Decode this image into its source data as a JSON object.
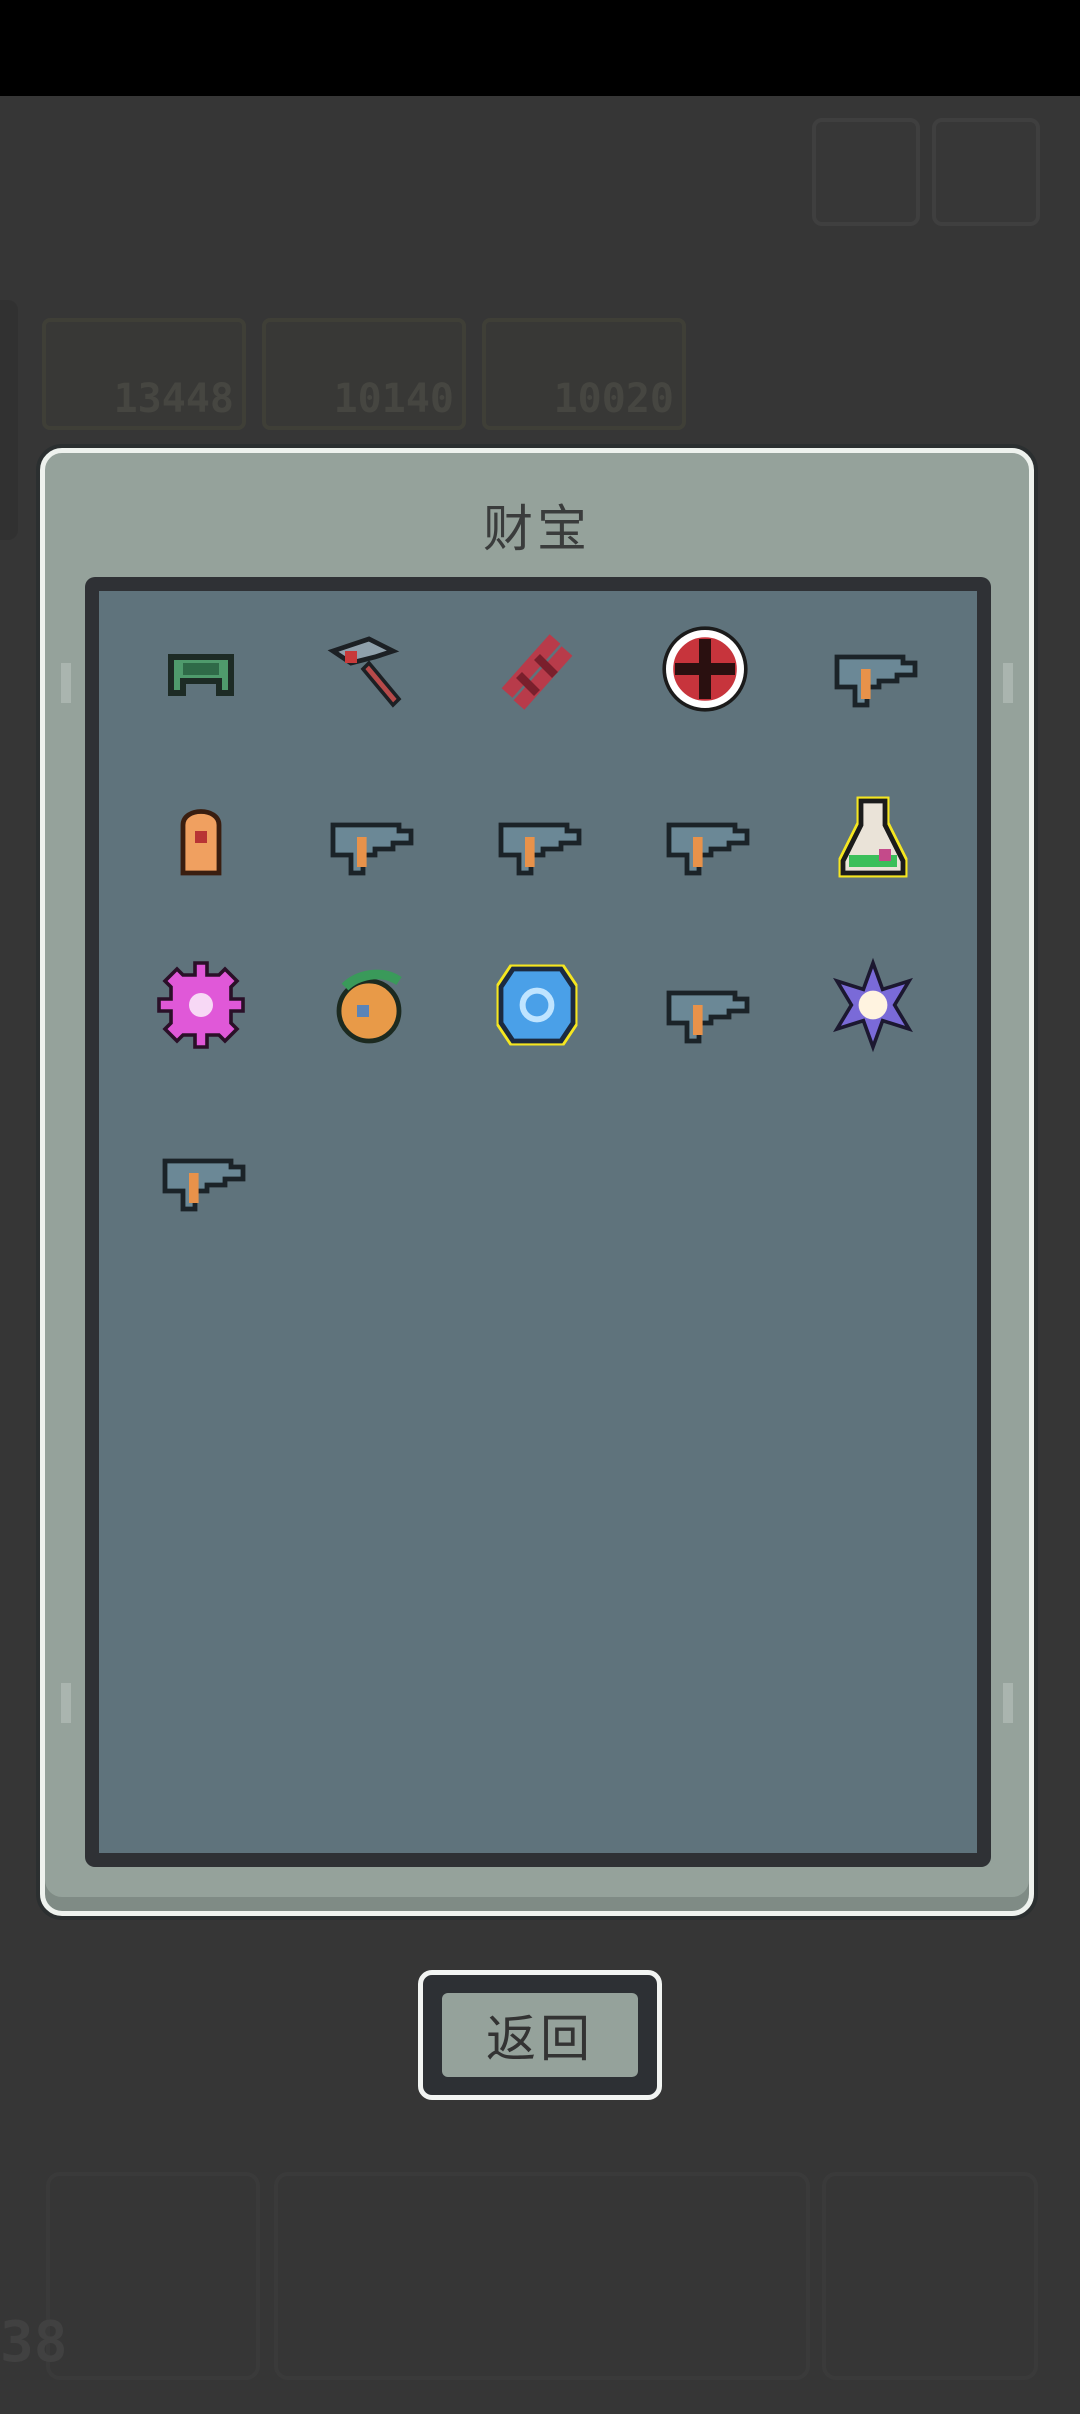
{
  "hud": {
    "resources": [
      "13448",
      "10140",
      "10020"
    ],
    "level": "38"
  },
  "treasure_panel": {
    "title": "财宝",
    "items": [
      {
        "icon": "green-helmet-icon"
      },
      {
        "icon": "pickaxe-icon"
      },
      {
        "icon": "red-dna-icon"
      },
      {
        "icon": "crosshair-icon"
      },
      {
        "icon": "pistol-icon"
      },
      {
        "icon": "orange-bullet-icon"
      },
      {
        "icon": "pistol-icon"
      },
      {
        "icon": "pistol-icon"
      },
      {
        "icon": "pistol-icon"
      },
      {
        "icon": "potion-flask-icon",
        "highlight": "#f5e620"
      },
      {
        "icon": "pink-gear-icon"
      },
      {
        "icon": "fruit-orb-icon"
      },
      {
        "icon": "blue-shield-icon",
        "highlight": "#f5e620"
      },
      {
        "icon": "pistol-icon"
      },
      {
        "icon": "violet-star-icon"
      },
      {
        "icon": "pistol-icon"
      }
    ]
  },
  "back_button": {
    "label": "返回"
  }
}
